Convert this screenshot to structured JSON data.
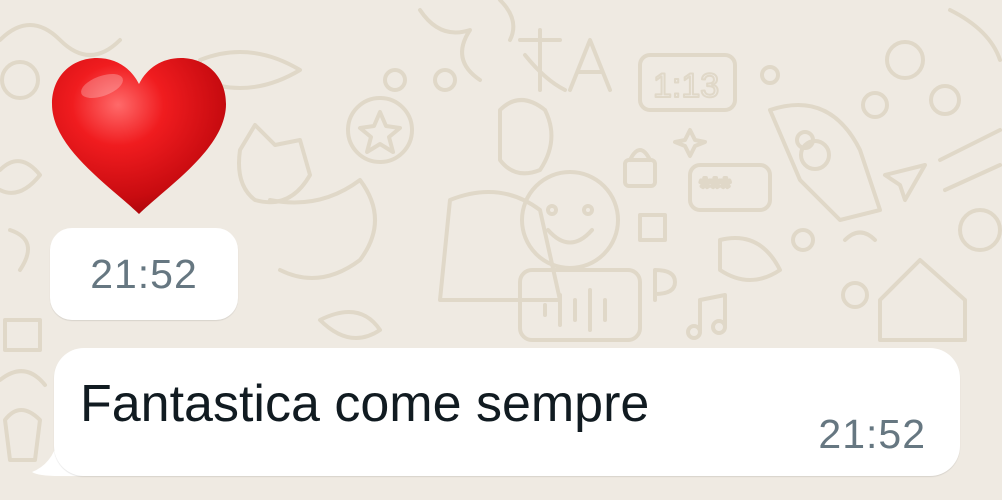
{
  "theme": {
    "chat_background": "#efeae2",
    "bubble_color": "#ffffff",
    "text_color": "#111b21",
    "timestamp_color": "#667781",
    "heart_color": "#e5131b"
  },
  "messages": [
    {
      "type": "emoji",
      "icon": "red-heart-icon",
      "time": "21:52"
    },
    {
      "type": "text",
      "text": "Fantastica come sempre",
      "time": "21:52"
    }
  ]
}
